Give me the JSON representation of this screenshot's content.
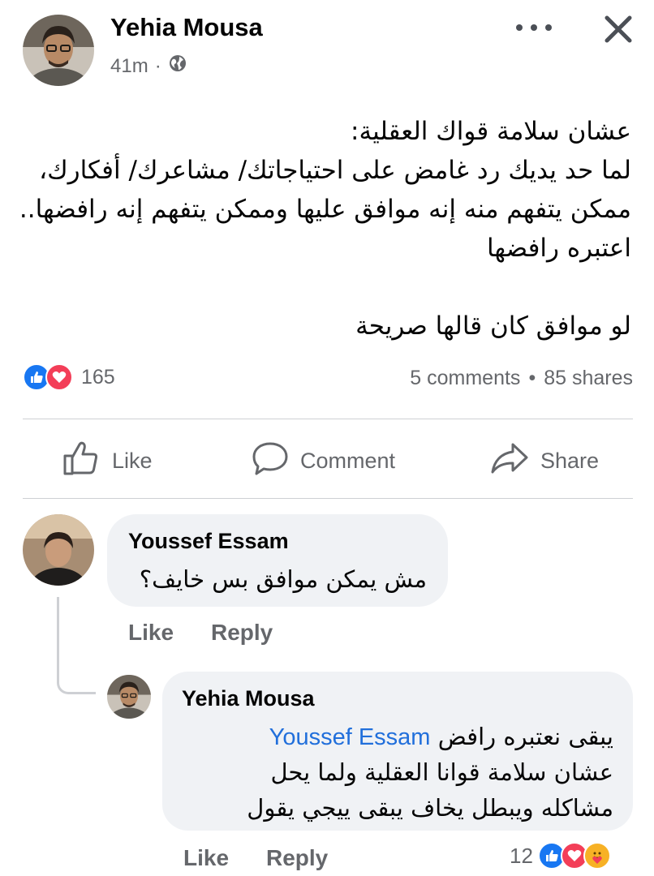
{
  "post": {
    "author": "Yehia Mousa",
    "time": "41m",
    "privacy_icon": "globe-icon",
    "text_lines": [
      "عشان سلامة قواك العقلية:",
      "لما حد يديك رد غامض على احتياجاتك/ مشاعرك/ أفكارك،",
      "ممكن يتفهم منه إنه موافق عليها وممكن يتفهم إنه رافضها..",
      "اعتبره رافضها",
      "لو موافق كان قالها صريحة"
    ],
    "reaction_count": "165",
    "comments_label": "5 comments",
    "shares_label": "85 shares",
    "stats_separator": "•"
  },
  "actions": {
    "like": "Like",
    "comment": "Comment",
    "share": "Share"
  },
  "comments": [
    {
      "author": "Youssef Essam",
      "text": "مش يمكن موافق بس خايف؟",
      "like_label": "Like",
      "reply_label": "Reply"
    }
  ],
  "reply": {
    "author": "Yehia Mousa",
    "mention": "Youssef Essam",
    "line1_text": "يبقى نعتبره رافض",
    "line2": "عشان سلامة قوانا العقلية ولما يحل",
    "line3": "مشاكله ويبطل يخاف يبقى ييجي يقول",
    "like_label": "Like",
    "reply_label": "Reply",
    "reaction_count": "12"
  },
  "colors": {
    "like_blue": "#1877f2",
    "love_red": "#f33e58",
    "care_yellow": "#f7b125",
    "mention_blue": "#216fdb",
    "secondary_text": "#65676b",
    "bubble_bg": "#f0f2f5"
  }
}
